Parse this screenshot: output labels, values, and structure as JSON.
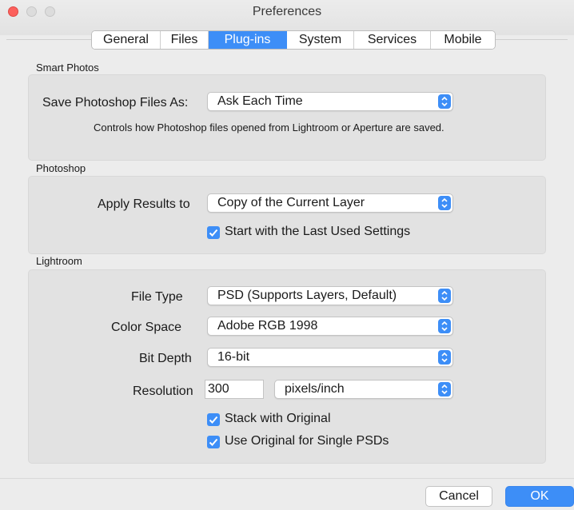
{
  "window": {
    "title": "Preferences",
    "accent_color": "#3d8ef7",
    "close_color": "#fc605c"
  },
  "tabs": [
    {
      "label": "General",
      "active": false
    },
    {
      "label": "Files",
      "active": false
    },
    {
      "label": "Plug-ins",
      "active": true
    },
    {
      "label": "System",
      "active": false
    },
    {
      "label": "Services",
      "active": false
    },
    {
      "label": "Mobile",
      "active": false
    }
  ],
  "smart_photos": {
    "heading": "Smart Photos",
    "save_label": "Save Photoshop Files As:",
    "save_value": "Ask Each Time",
    "hint": "Controls how Photoshop files opened from Lightroom or Aperture are saved."
  },
  "photoshop": {
    "heading": "Photoshop",
    "apply_label": "Apply Results to",
    "apply_value": "Copy of the Current Layer",
    "last_settings_label": "Start with the Last Used Settings",
    "last_settings_checked": true
  },
  "lightroom": {
    "heading": "Lightroom",
    "file_type_label": "File Type",
    "file_type_value": "PSD (Supports Layers, Default)",
    "color_space_label": "Color Space",
    "color_space_value": "Adobe RGB 1998",
    "bit_depth_label": "Bit Depth",
    "bit_depth_value": "16-bit",
    "resolution_label": "Resolution",
    "resolution_value": "300",
    "resolution_unit": "pixels/inch",
    "stack_label": "Stack with Original",
    "stack_checked": true,
    "single_psd_label": "Use Original for Single PSDs",
    "single_psd_checked": true
  },
  "footer": {
    "cancel_label": "Cancel",
    "ok_label": "OK"
  }
}
